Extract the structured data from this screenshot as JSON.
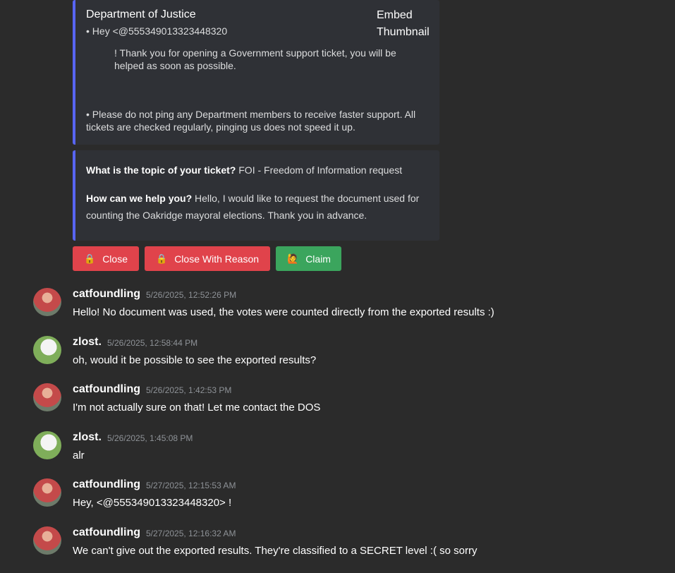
{
  "embed1": {
    "title": "Department of Justice",
    "line1": "• Hey <@555349013323448320",
    "line2": "! Thank you for opening a Government support ticket, you will be helped as soon as possible.",
    "line3": "• Please do not ping any Department members to receive faster support. All tickets are checked regularly, pinging us does not speed it up.",
    "thumbnail_alt": "Embed Thumbnail"
  },
  "embed2": {
    "q1_label": "What is the topic of your ticket?",
    "q1_answer": " FOI - Freedom of Information request",
    "q2_label": "How can we help you?",
    "q2_answer": " Hello, I would like to request the document used for counting the Oakridge mayoral elections. Thank you in advance."
  },
  "buttons": {
    "close": "Close",
    "close_reason": "Close With Reason",
    "claim": "Claim",
    "close_icon": "🔒",
    "claim_icon": "🙋"
  },
  "messages": [
    {
      "user": "catfoundling",
      "time": "5/26/2025, 12:52:26 PM",
      "text": "Hello! No document was used, the votes were counted directly from the exported results :)"
    },
    {
      "user": "zlost.",
      "time": "5/26/2025, 12:58:44 PM",
      "text": "oh, would it be possible to see the exported results?"
    },
    {
      "user": "catfoundling",
      "time": "5/26/2025, 1:42:53 PM",
      "text": "I'm not actually sure on that! Let me contact the DOS"
    },
    {
      "user": "zlost.",
      "time": "5/26/2025, 1:45:08 PM",
      "text": "alr"
    },
    {
      "user": "catfoundling",
      "time": "5/27/2025, 12:15:53 AM",
      "text": "Hey, <@555349013323448320> !"
    },
    {
      "user": "catfoundling",
      "time": "5/27/2025, 12:16:32 AM",
      "text": "We can't give out the exported results. They're classified to a SECRET level :( so sorry"
    }
  ]
}
